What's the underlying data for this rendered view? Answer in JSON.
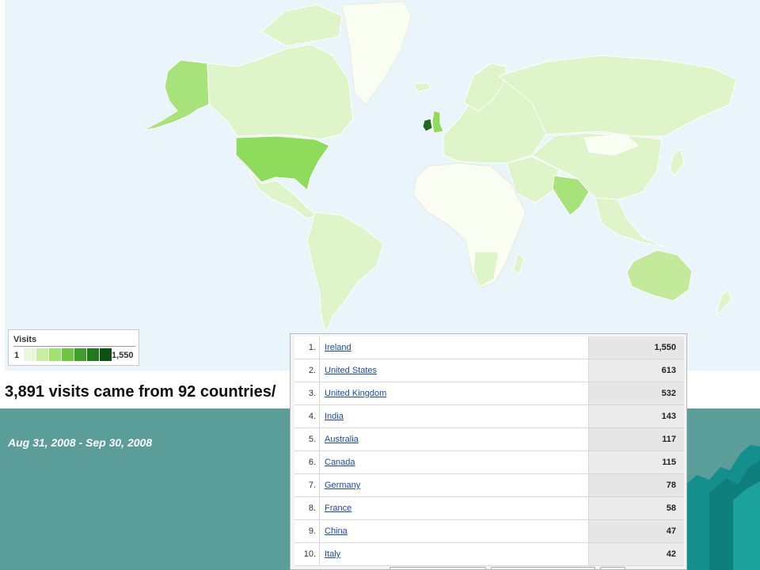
{
  "colors": {
    "ocean": "#eaf4fb",
    "land_none": "#fbfdf3",
    "land_low": "#ddf4c6",
    "land_mid": "#c2ea9a",
    "land_high": "#8fdc5c",
    "land_top": "#1e6b1e",
    "teal_bg": "#5b9d99",
    "link": "#1a47b8"
  },
  "legend": {
    "title": "Visits",
    "min": "1",
    "max": "1,550",
    "swatches": [
      "#eaf9dc",
      "#c8ef9f",
      "#9fe270",
      "#6cc842",
      "#3f9e2a",
      "#227a1f",
      "#0f4f12"
    ]
  },
  "summary": {
    "headline": "3,891 visits came from 92 countries/"
  },
  "date_range": "Aug 31, 2008 - Sep 30, 2008",
  "table": {
    "rows": [
      {
        "rank": "1.",
        "country": "Ireland",
        "visits": "1,550"
      },
      {
        "rank": "2.",
        "country": "United States",
        "visits": "613"
      },
      {
        "rank": "3.",
        "country": "United Kingdom",
        "visits": "532"
      },
      {
        "rank": "4.",
        "country": "India",
        "visits": "143"
      },
      {
        "rank": "5.",
        "country": "Australia",
        "visits": "117"
      },
      {
        "rank": "6.",
        "country": "Canada",
        "visits": "115"
      },
      {
        "rank": "7.",
        "country": "Germany",
        "visits": "78"
      },
      {
        "rank": "8.",
        "country": "France",
        "visits": "58"
      },
      {
        "rank": "9.",
        "country": "China",
        "visits": "47"
      },
      {
        "rank": "10.",
        "country": "Italy",
        "visits": "42"
      }
    ]
  }
}
